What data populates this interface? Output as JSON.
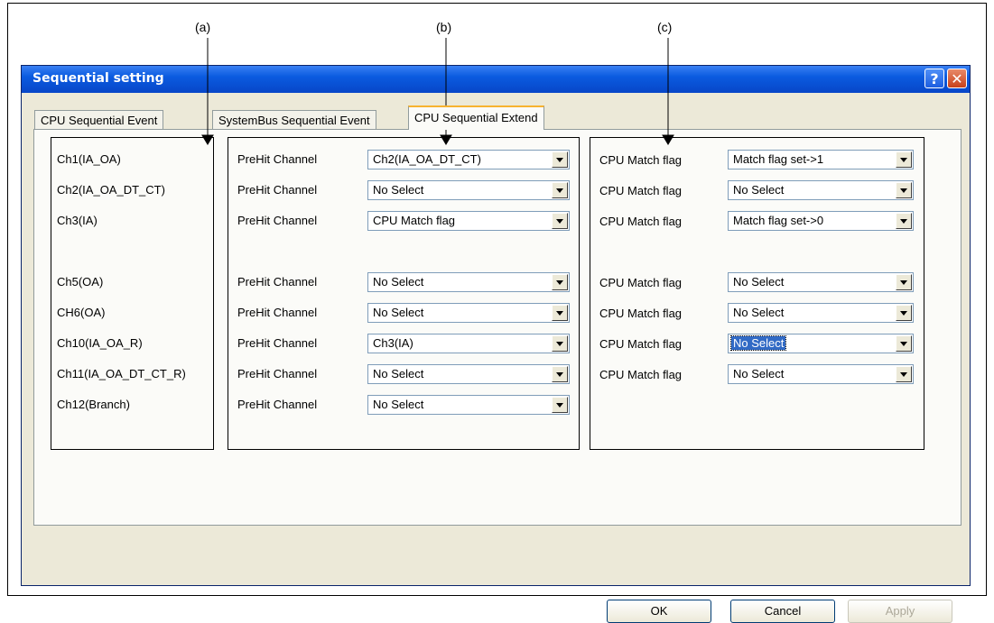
{
  "callouts": {
    "a": "(a)",
    "b": "(b)",
    "c": "(c)"
  },
  "window": {
    "title": "Sequential setting",
    "help_glyph": "?",
    "close_glyph": "✕"
  },
  "tabs": [
    "CPU Sequential Event",
    "SystemBus Sequential Event",
    "CPU Sequential Extend"
  ],
  "active_tab": "CPU Sequential Extend",
  "channels": [
    "Ch1(IA_OA)",
    "Ch2(IA_OA_DT_CT)",
    "Ch3(IA)",
    "Ch5(OA)",
    "CH6(OA)",
    "Ch10(IA_OA_R)",
    "Ch11(IA_OA_DT_CT_R)",
    "Ch12(Branch)"
  ],
  "prehit": {
    "label": "PreHit Channel",
    "values": [
      "Ch2(IA_OA_DT_CT)",
      "No Select",
      "CPU Match flag",
      "No Select",
      "No Select",
      "Ch3(IA)",
      "No Select",
      "No Select"
    ]
  },
  "match": {
    "label": "CPU Match flag",
    "values": [
      "Match flag set->1",
      "No Select",
      "Match flag set->0",
      "No Select",
      "No Select",
      "No Select",
      "No Select"
    ],
    "focused_index": 5
  },
  "buttons": {
    "ok": "OK",
    "cancel": "Cancel",
    "apply": "Apply"
  },
  "colors": {
    "titlebar": "#0a5be0",
    "dialog_bg": "#ece9d8",
    "selection": "#316ac5"
  }
}
